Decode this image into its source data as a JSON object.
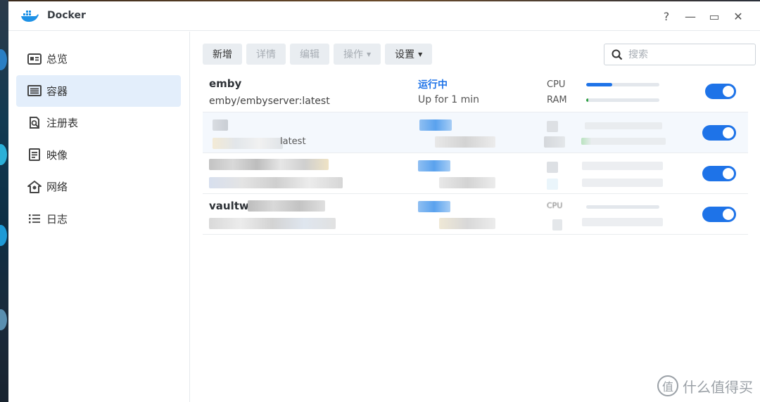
{
  "window": {
    "title": "Docker",
    "controls": [
      "?",
      "—",
      "▭",
      "✕"
    ]
  },
  "sidebar": {
    "items": [
      {
        "label": "总览",
        "icon": "overview-icon"
      },
      {
        "label": "容器",
        "icon": "container-icon",
        "active": true
      },
      {
        "label": "注册表",
        "icon": "registry-search-icon"
      },
      {
        "label": "映像",
        "icon": "image-icon"
      },
      {
        "label": "网络",
        "icon": "network-icon"
      },
      {
        "label": "日志",
        "icon": "log-list-icon"
      }
    ]
  },
  "toolbar": {
    "add_label": "新增",
    "details_label": "详情",
    "edit_label": "编辑",
    "action_label": "操作",
    "settings_label": "设置"
  },
  "search": {
    "placeholder": "搜索"
  },
  "containers": [
    {
      "name": "emby",
      "image": "emby/embyserver:latest",
      "status": "运行中",
      "uptime": "Up for 1 min",
      "cpu_label": "CPU",
      "ram_label": "RAM",
      "cpu_usage": 0.36,
      "ram_usage": 0.03,
      "enabled": true
    },
    {
      "image_suffix": "latest",
      "enabled": true
    },
    {
      "enabled": true
    },
    {
      "name_prefix": "vaultw",
      "cpu_label": "CPU",
      "enabled": true
    }
  ],
  "colors": {
    "accent": "#1e73e8",
    "cpu_bar": "#1e73e8",
    "ram_bar": "#2ea043",
    "active_nav": "#e3eefb"
  },
  "watermark": {
    "text": "什么值得买",
    "icon": "smzdm-logo-icon"
  }
}
